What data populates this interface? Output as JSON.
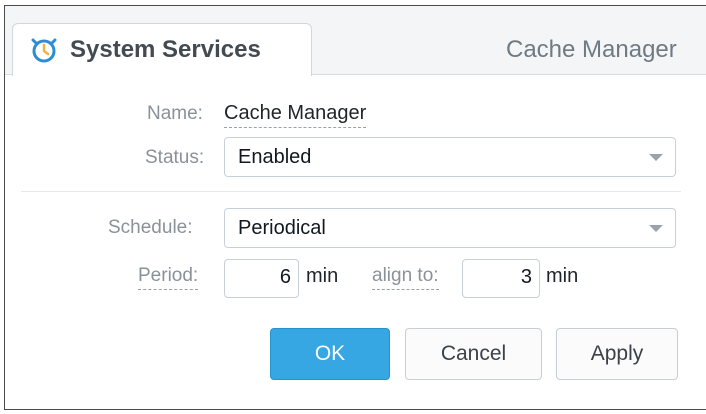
{
  "header": {
    "tab_title": "System Services",
    "right_title": "Cache Manager"
  },
  "form": {
    "name_label": "Name:",
    "name_value": "Cache Manager",
    "status_label": "Status:",
    "status_value": "Enabled",
    "schedule_label": "Schedule:",
    "schedule_value": "Periodical",
    "period_label": "Period:",
    "period_value": "6",
    "period_unit": "min",
    "align_label": "align to:",
    "align_value": "3",
    "align_unit": "min"
  },
  "buttons": {
    "ok_label": "OK",
    "cancel_label": "Cancel",
    "apply_label": "Apply"
  },
  "icons": {
    "tab_icon": "alarm-clock-icon",
    "select_arrow": "chevron-down-icon"
  },
  "colors": {
    "accent": "#36a7e3",
    "tab_icon_primary": "#2f8bd4",
    "tab_icon_secondary": "#f3b23b"
  }
}
